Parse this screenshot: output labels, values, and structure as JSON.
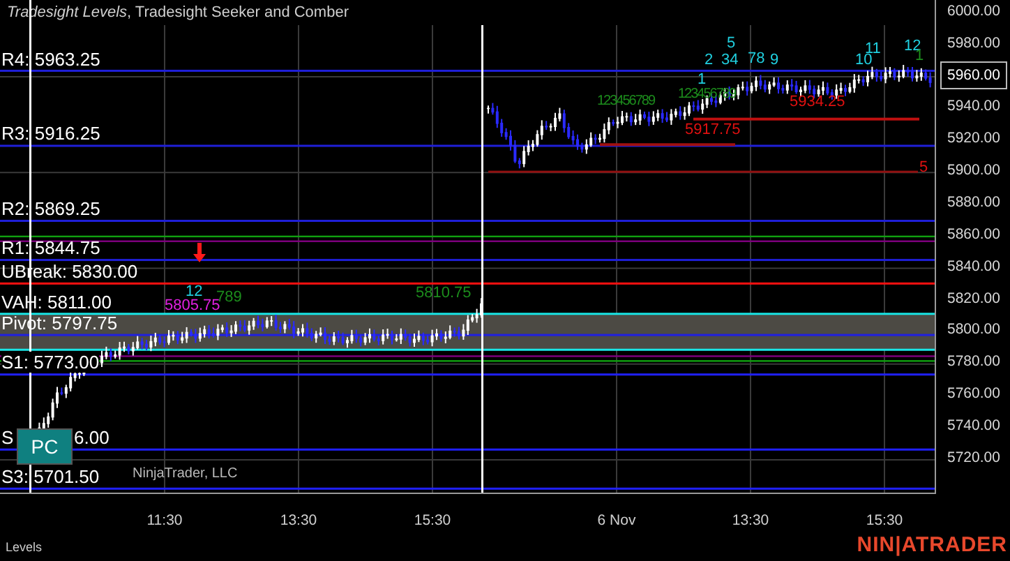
{
  "title": {
    "indicator": "Tradesight Levels",
    "rest": ", Tradesight Seeker and Comber"
  },
  "levels": [
    {
      "label": "R4: 5963.25",
      "color": "#1f1fd8"
    },
    {
      "label": "R3: 5916.25",
      "color": "#1f1fd8"
    },
    {
      "label": "R2: 5869.25",
      "color": "#1f1fd8"
    },
    {
      "label": "R1: 5844.75",
      "color": "#1f1fd8"
    },
    {
      "label": "UBreak: 5830.00",
      "color": "#ff1010"
    },
    {
      "label": "VAH: 5811.00",
      "color": "#19e6e6"
    },
    {
      "label": "Pivot: 5797.75",
      "color": "#2020e0"
    },
    {
      "label": "S1: 5773.00",
      "color": "#2020ff"
    },
    {
      "label": "S",
      "tail": "6.00",
      "color": "#2020ff"
    },
    {
      "label": "S3: 5701.50",
      "color": "#2020ff"
    }
  ],
  "annotations": [
    {
      "text": "5934.25",
      "color": "#e01010"
    },
    {
      "text": "5917.75",
      "color": "#e01010"
    },
    {
      "text": "5",
      "color": "#e01010"
    },
    {
      "text": "5810.75",
      "color": "#1c8c1c"
    },
    {
      "text": "5805.75",
      "color": "#e020e0"
    },
    {
      "text": "12",
      "color": "#20d0e0"
    },
    {
      "text": "789",
      "color": "#1c8c1c"
    },
    {
      "text": "5",
      "color": "#20d0e0"
    },
    {
      "text": "1",
      "color": "#20d0e0"
    },
    {
      "text": "2",
      "color": "#20d0e0"
    },
    {
      "text": "34",
      "color": "#20d0e0"
    },
    {
      "text": "78",
      "color": "#20d0e0"
    },
    {
      "text": "9",
      "color": "#20d0e0"
    },
    {
      "text": "10",
      "color": "#20d0e0"
    },
    {
      "text": "11",
      "color": "#20d0e0"
    },
    {
      "text": "12",
      "color": "#20d0e0"
    },
    {
      "text": "1",
      "color": "#1c8c1c"
    },
    {
      "text": "123456789",
      "color": "#1c8c1c"
    },
    {
      "text": "123456789",
      "color": "#1c8c1c"
    }
  ],
  "price_axis": {
    "ticks": [
      "6000.00",
      "5980.00",
      "5940.00",
      "5920.00",
      "5900.00",
      "5880.00",
      "5860.00",
      "5840.00",
      "5820.00",
      "5800.00",
      "5780.00",
      "5760.00",
      "5740.00",
      "5720.00"
    ],
    "current": "5960.00"
  },
  "time_axis": [
    "11:30",
    "13:30",
    "15:30",
    "6 Nov",
    "13:30",
    "15:30"
  ],
  "badge": "PC",
  "copyright": "NinjaTrader, LLC",
  "tab": "Levels",
  "logo": "NIN|ATRADER"
}
